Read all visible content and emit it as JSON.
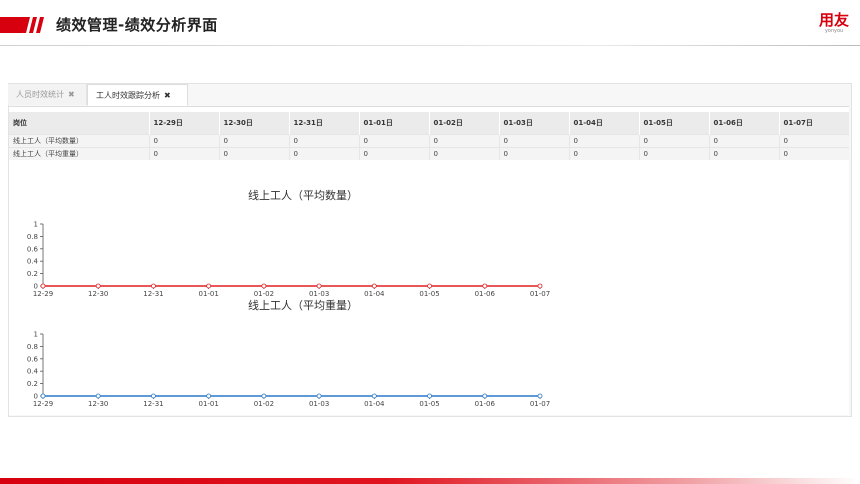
{
  "header": {
    "title": "绩效管理-绩效分析界面",
    "logo_main": "用友",
    "logo_sub": "yonyou",
    "brand_color": "#d7000f"
  },
  "tabs": [
    {
      "label": "人员时效统计",
      "close": "✖",
      "active": false
    },
    {
      "label": "工人时效跟踪分析",
      "close": "✖",
      "active": true
    }
  ],
  "table": {
    "headers": [
      "岗位",
      "12-29日",
      "12-30日",
      "12-31日",
      "01-01日",
      "01-02日",
      "01-03日",
      "01-04日",
      "01-05日",
      "01-06日",
      "01-07日"
    ],
    "rows": [
      [
        "线上工人（平均数量）",
        "0",
        "0",
        "0",
        "0",
        "0",
        "0",
        "0",
        "0",
        "0",
        "0"
      ],
      [
        "线上工人（平均重量）",
        "0",
        "0",
        "0",
        "0",
        "0",
        "0",
        "0",
        "0",
        "0",
        "0"
      ]
    ]
  },
  "chart_data": [
    {
      "type": "line",
      "title": "线上工人（平均数量）",
      "x": [
        "12-29",
        "12-30",
        "12-31",
        "01-01",
        "01-02",
        "01-03",
        "01-04",
        "01-05",
        "01-06",
        "01-07"
      ],
      "series": [
        {
          "values": [
            0,
            0,
            0,
            0,
            0,
            0,
            0,
            0,
            0,
            0
          ],
          "color": "#e02020"
        }
      ],
      "yticks": [
        "0",
        "0.2",
        "0.4",
        "0.6",
        "0.8",
        "1"
      ],
      "ylim": [
        0,
        1
      ],
      "xlabel": "",
      "ylabel": "",
      "grid": false
    },
    {
      "type": "line",
      "title": "线上工人（平均重量）",
      "x": [
        "12-29",
        "12-30",
        "12-31",
        "01-01",
        "01-02",
        "01-03",
        "01-04",
        "01-05",
        "01-06",
        "01-07"
      ],
      "series": [
        {
          "values": [
            0,
            0,
            0,
            0,
            0,
            0,
            0,
            0,
            0,
            0
          ],
          "color": "#2a78c8"
        }
      ],
      "yticks": [
        "0",
        "0.2",
        "0.4",
        "0.6",
        "0.8",
        "1"
      ],
      "ylim": [
        0,
        1
      ],
      "xlabel": "",
      "ylabel": "",
      "grid": false
    }
  ]
}
